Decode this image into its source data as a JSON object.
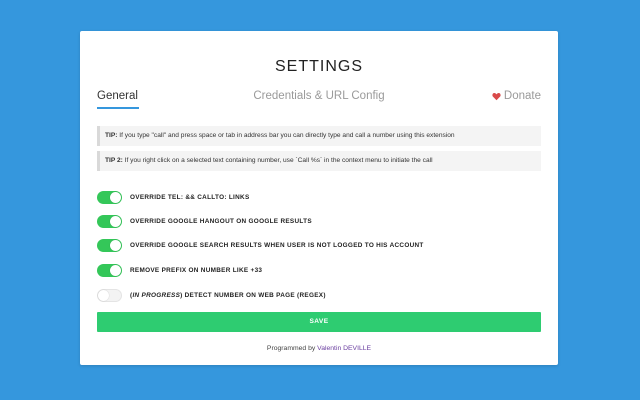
{
  "title": "SETTINGS",
  "tabs": {
    "general": "General",
    "credentials": "Credentials & URL Config",
    "donate": "Donate"
  },
  "tips": {
    "tip1_label": "TIP:",
    "tip1_text": " If you type \"call\" and press space or tab in address bar you can directly type and call a number using this extension",
    "tip2_label": "TIP 2:",
    "tip2_text": " If you right click on a selected text containing number, use `Call %s` in the context menu to initiate the call"
  },
  "options": [
    {
      "label": "OVERRIDE TEL: && CALLTO: LINKS",
      "enabled": true
    },
    {
      "label": "OVERRIDE GOOGLE HANGOUT ON GOOGLE RESULTS",
      "enabled": true
    },
    {
      "label": "OVERRIDE GOOGLE SEARCH RESULTS WHEN USER IS NOT LOGGED TO HIS ACCOUNT",
      "enabled": true
    },
    {
      "label": "REMOVE PREFIX ON NUMBER LIKE +33",
      "enabled": true
    },
    {
      "label_prefix": "(",
      "label_italic": "IN PROGRESS",
      "label_suffix": ") DETECT NUMBER ON WEB PAGE (REGEX)",
      "enabled": false
    }
  ],
  "save_label": "SAVE",
  "footer": {
    "text": "Programmed by ",
    "author": "Valentin DEVILLE"
  },
  "colors": {
    "background": "#3597dd",
    "toggle_on": "#34c759",
    "save": "#2ecc71",
    "tab_underline": "#3597dd",
    "heart": "#d94a4a",
    "author_link": "#6b3fa0"
  }
}
